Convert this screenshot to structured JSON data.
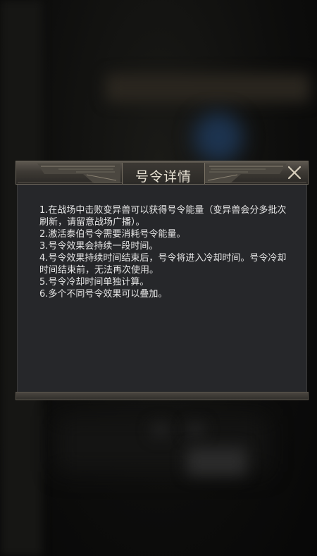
{
  "dialog": {
    "title": "号令详情",
    "close_icon": "close-icon",
    "rules": [
      "1.在战场中击败变异兽可以获得号令能量（变异兽会分多批次刷新，请留意战场广播）。",
      "2.激活泰伯号令需要消耗号令能量。",
      "3.号令效果会持续一段时间。",
      "4.号令效果持续时间结束后，号令将进入冷却时间。号令冷却时间结束前，无法再次使用。",
      "5.号令冷却时间单独计算。",
      "6.多个不同号令效果可以叠加。"
    ]
  },
  "colors": {
    "panel_body": "#26272a",
    "header_gold": "#7a7366",
    "text": "#e6e6e6",
    "title_text": "#e8e2d4"
  }
}
